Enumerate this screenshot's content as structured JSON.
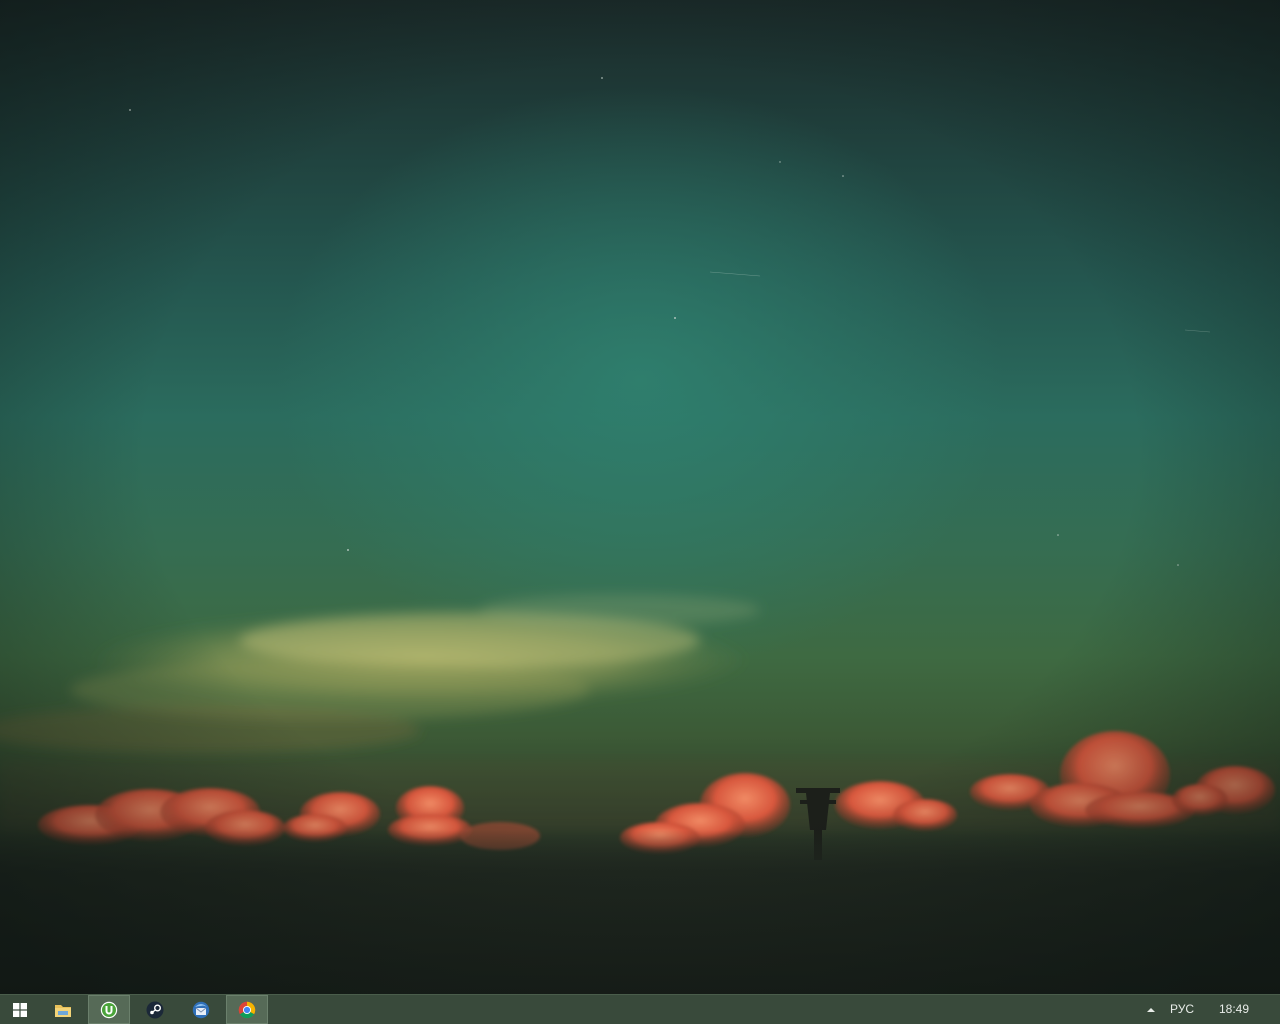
{
  "desktop": {
    "wallpaper": "sunset-sky-clouds"
  },
  "taskbar": {
    "background_color": "#394a3b",
    "start_icon": "windows-logo-icon",
    "pinned": [
      {
        "name": "file-explorer",
        "icon": "folder-icon",
        "active": false
      },
      {
        "name": "utorrent",
        "icon": "utorrent-icon",
        "active": true
      },
      {
        "name": "steam",
        "icon": "steam-icon",
        "active": false
      },
      {
        "name": "thunderbird",
        "icon": "thunderbird-icon",
        "active": false
      },
      {
        "name": "chrome",
        "icon": "chrome-icon",
        "active": true
      }
    ],
    "tray": {
      "chevron_icon": "chevron-up-icon",
      "language": "РУС",
      "time": "18:49"
    }
  }
}
